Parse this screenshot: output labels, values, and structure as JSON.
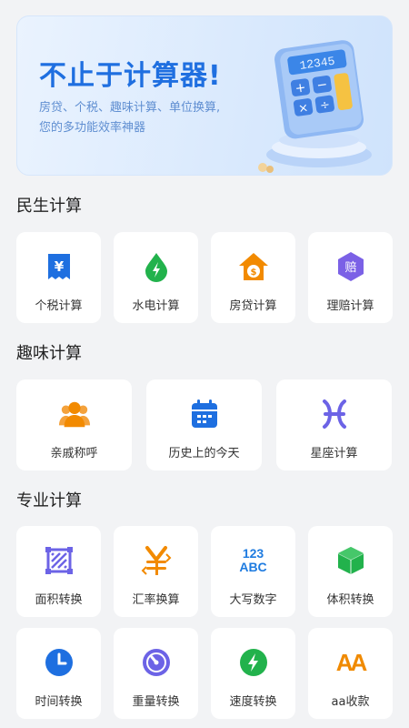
{
  "banner": {
    "title": "不止于计算器!",
    "subtitle_line1": "房贷、个税、趣味计算、单位换算,",
    "subtitle_line2": "您的多功能效率神器",
    "display_text": "12345"
  },
  "sections": {
    "livelihood": {
      "title": "民生计算",
      "items": [
        {
          "label": "个税计算",
          "icon": "yen-receipt-icon",
          "color": "#1e6fe0"
        },
        {
          "label": "水电计算",
          "icon": "drop-bolt-icon",
          "color": "#22b24c"
        },
        {
          "label": "房贷计算",
          "icon": "house-dollar-icon",
          "color": "#f28a00"
        },
        {
          "label": "理赔计算",
          "icon": "hexagon-claim-icon",
          "color": "#7b61e6",
          "glyph": "赔"
        }
      ]
    },
    "fun": {
      "title": "趣味计算",
      "items": [
        {
          "label": "亲戚称呼",
          "icon": "people-icon",
          "color": "#f28a00"
        },
        {
          "label": "历史上的今天",
          "icon": "calendar-icon",
          "color": "#1e6fe0"
        },
        {
          "label": "星座计算",
          "icon": "pisces-icon",
          "color": "#6c63e6"
        }
      ]
    },
    "professional": {
      "title": "专业计算",
      "items": [
        {
          "label": "面积转换",
          "icon": "area-icon",
          "color": "#6c63e6"
        },
        {
          "label": "汇率换算",
          "icon": "yen-exchange-icon",
          "color": "#f28a00"
        },
        {
          "label": "大写数字",
          "icon": "123abc-icon",
          "color": "#1e7be0",
          "glyph_top": "123",
          "glyph_bottom": "ABC"
        },
        {
          "label": "体积转换",
          "icon": "cube-icon",
          "color": "#22b24c"
        },
        {
          "label": "时间转换",
          "icon": "clock-icon",
          "color": "#1e6fe0"
        },
        {
          "label": "重量转换",
          "icon": "gauge-icon",
          "color": "#6c63e6"
        },
        {
          "label": "速度转换",
          "icon": "bolt-circle-icon",
          "color": "#22b24c"
        },
        {
          "label": "aa收款",
          "icon": "aa-icon",
          "color": "#f08a00",
          "glyph": "AA"
        }
      ]
    }
  }
}
